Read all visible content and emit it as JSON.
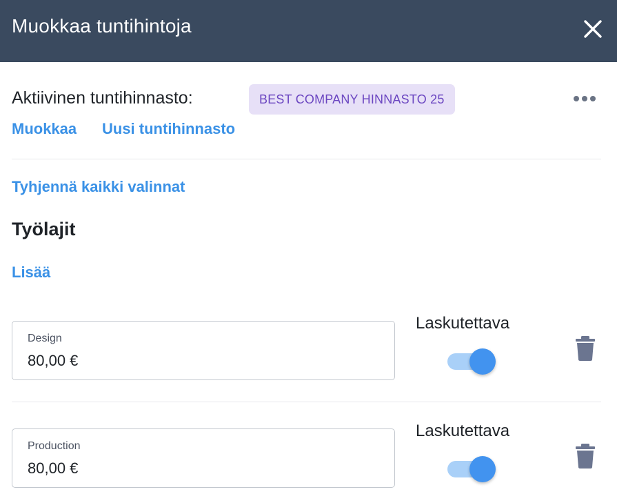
{
  "header": {
    "title": "Muokkaa tuntihintoja",
    "close_icon": "close-icon"
  },
  "price_list": {
    "active_label": "Aktiivinen tuntihinnasto:",
    "active_name": "BEST COMPANY HINNASTO 25",
    "more_icon": "more-horizontal-icon",
    "edit_link": "Muokkaa",
    "new_link": "Uusi tuntihinnasto"
  },
  "clear_all_link": "Tyhjennä kaikki valinnat",
  "work_types": {
    "title": "Työlajit",
    "add_link": "Lisää",
    "items": [
      {
        "label": "Design",
        "value": "80,00 €",
        "billable_label": "Laskutettava",
        "billable": true
      },
      {
        "label": "Production",
        "value": "80,00 €",
        "billable_label": "Laskutettava",
        "billable": true
      }
    ]
  },
  "colors": {
    "header_bg": "#3a4a5f",
    "link": "#3a91e6",
    "badge_bg": "#e7e0f7",
    "badge_text": "#6b46c1",
    "toggle_thumb": "#4293ef",
    "toggle_track": "#a9d0f8",
    "trash_icon": "#6b7590"
  }
}
